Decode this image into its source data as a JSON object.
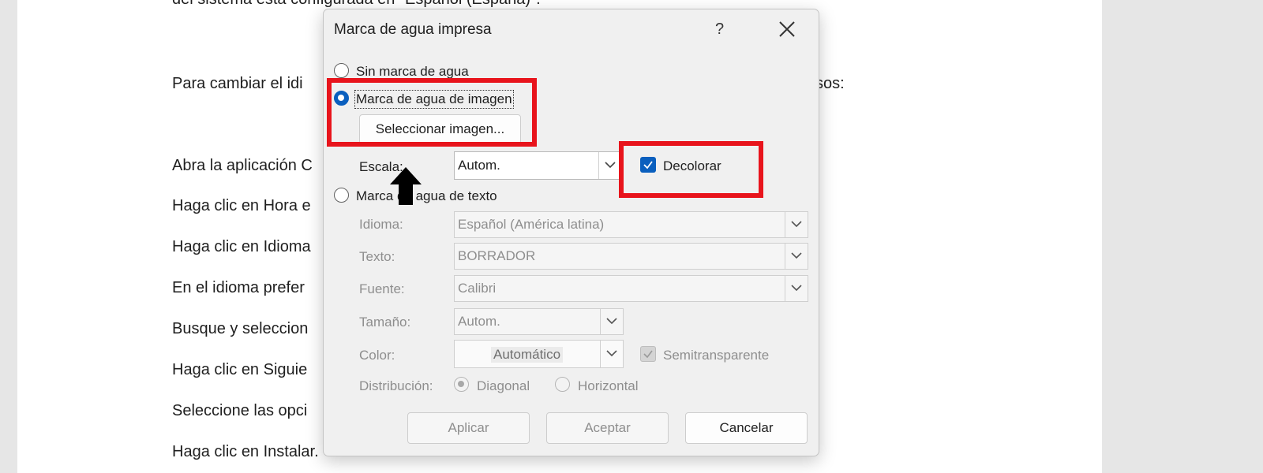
{
  "document": {
    "lines": [
      "del sistema está configurada en \"Español (España)\".",
      "Para cambiar el idi",
      "Abra la aplicación C",
      "Haga clic en Hora e",
      "Haga clic en Idioma",
      "En el idioma prefer",
      "Busque y seleccion",
      "Haga clic en Siguie",
      "Seleccione las opci",
      "Haga clic en Instalar."
    ],
    "right_fragment": "sos:"
  },
  "dialog": {
    "title": "Marca de agua impresa",
    "help_label": "?",
    "no_watermark_label": "Sin marca de agua",
    "picture_watermark_label": "Marca de agua de imagen",
    "select_picture_label": "Seleccionar imagen...",
    "scale_label": "Escala:",
    "scale_value": "Autom.",
    "washout_label": "Decolorar",
    "washout_checked": true,
    "text_watermark_label": "Marca de agua de texto",
    "language_label": "Idioma:",
    "language_value": "Español (América latina)",
    "text_label": "Texto:",
    "text_value": "BORRADOR",
    "font_label": "Fuente:",
    "font_value": "Calibri",
    "size_label": "Tamaño:",
    "size_value": "Autom.",
    "color_label": "Color:",
    "color_value": "Automático",
    "semitransparent_label": "Semitransparente",
    "layout_label": "Distribución:",
    "diagonal_label": "Diagonal",
    "horizontal_label": "Horizontal",
    "apply_label": "Aplicar",
    "ok_label": "Aceptar",
    "cancel_label": "Cancelar",
    "selected_option": "picture"
  },
  "annotations": {
    "highlight_color": "#e8141c",
    "arrow_color": "#000000"
  }
}
